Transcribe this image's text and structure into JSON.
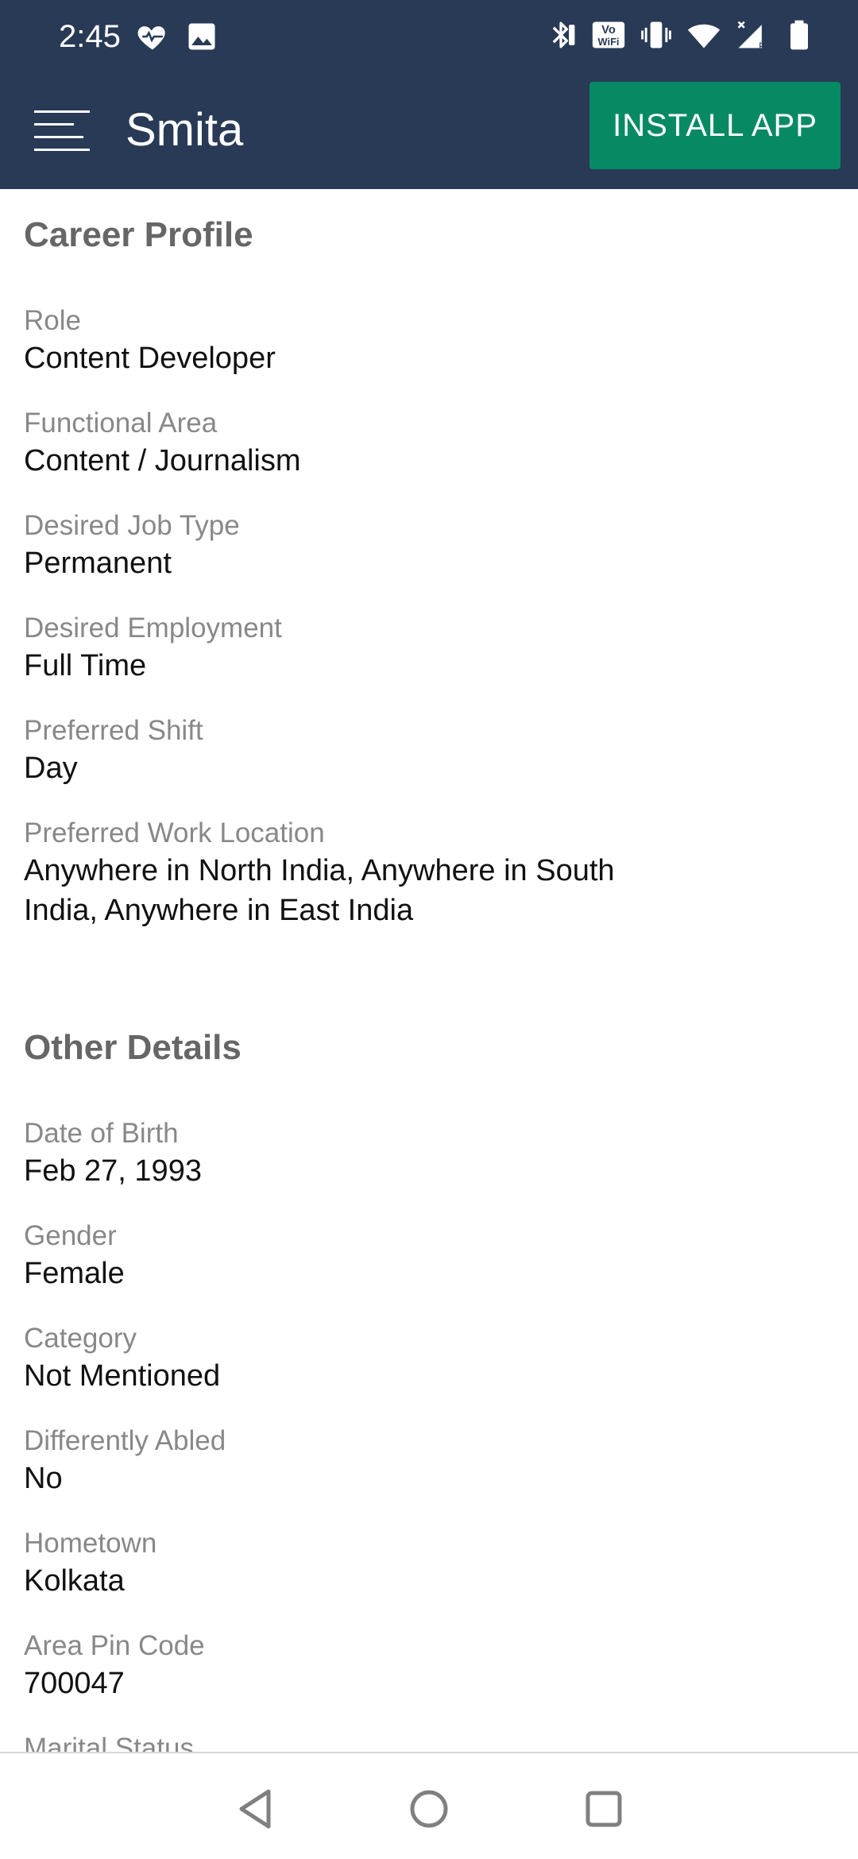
{
  "status_bar": {
    "time": "2:45",
    "left_icons": [
      "heart-icon",
      "image-icon"
    ],
    "right_icons": [
      "bluetooth-icon",
      "vowifi-icon",
      "vibrate-icon",
      "wifi-icon",
      "signal-icon",
      "battery-icon"
    ],
    "vowifi_text_top": "Vo",
    "vowifi_text_bottom": "WiFi"
  },
  "app_bar": {
    "title": "Smita",
    "install_label": "INSTALL APP",
    "menu_icon": "menu-icon"
  },
  "career_profile": {
    "title": "Career Profile",
    "fields": [
      {
        "label": "Role",
        "value": "Content Developer"
      },
      {
        "label": "Functional Area",
        "value": "Content / Journalism"
      },
      {
        "label": "Desired Job Type",
        "value": "Permanent"
      },
      {
        "label": "Desired Employment",
        "value": "Full Time"
      },
      {
        "label": "Preferred Shift",
        "value": "Day"
      },
      {
        "label": "Preferred Work Location",
        "value": "Anywhere in North India, Anywhere in South India, Anywhere in East India"
      }
    ]
  },
  "other_details": {
    "title": "Other Details",
    "fields": [
      {
        "label": "Date of Birth",
        "value": "Feb 27, 1993"
      },
      {
        "label": "Gender",
        "value": "Female"
      },
      {
        "label": "Category",
        "value": "Not Mentioned"
      },
      {
        "label": "Differently Abled",
        "value": "No"
      },
      {
        "label": "Hometown",
        "value": "Kolkata"
      },
      {
        "label": "Area Pin Code",
        "value": "700047"
      },
      {
        "label": "Marital Status",
        "value": ""
      }
    ]
  },
  "nav_bar": {
    "buttons": [
      "back-icon",
      "home-icon",
      "recents-icon"
    ]
  },
  "colors": {
    "header_bg": "#283a55",
    "install_bg": "#078a63",
    "section_title": "#666666",
    "label": "#888888",
    "value": "#111111"
  }
}
